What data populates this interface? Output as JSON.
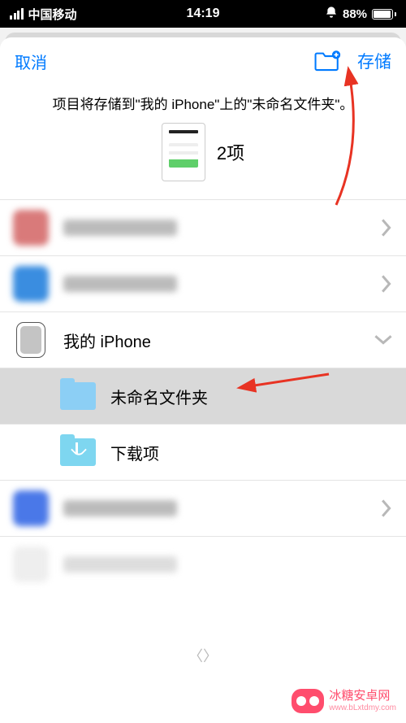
{
  "status": {
    "carrier": "中国移动",
    "time": "14:19",
    "battery_pct": "88%"
  },
  "nav": {
    "cancel": "取消",
    "save": "存储"
  },
  "description": "项目将存储到\"我的 iPhone\"上的\"未命名文件夹\"。",
  "preview": {
    "count_label": "2项"
  },
  "locations": [
    {
      "id": "blur1",
      "label": "",
      "type": "blurred"
    },
    {
      "id": "blur2",
      "label": "",
      "type": "blurred"
    },
    {
      "id": "my_iphone",
      "label": "我的 iPhone",
      "type": "device",
      "expanded": true
    },
    {
      "id": "unnamed_folder",
      "label": "未命名文件夹",
      "type": "folder",
      "child": true,
      "selected": true
    },
    {
      "id": "downloads",
      "label": "下载项",
      "type": "folder-dl",
      "child": true
    },
    {
      "id": "blur3",
      "label": "",
      "type": "blurred"
    },
    {
      "id": "blur4",
      "label": "",
      "type": "blurred-light"
    }
  ],
  "watermark": {
    "title": "冰糖安卓网",
    "url": "www.bLxtdmy.com"
  },
  "colors": {
    "accent": "#007aff",
    "arrow": "#e83323"
  }
}
